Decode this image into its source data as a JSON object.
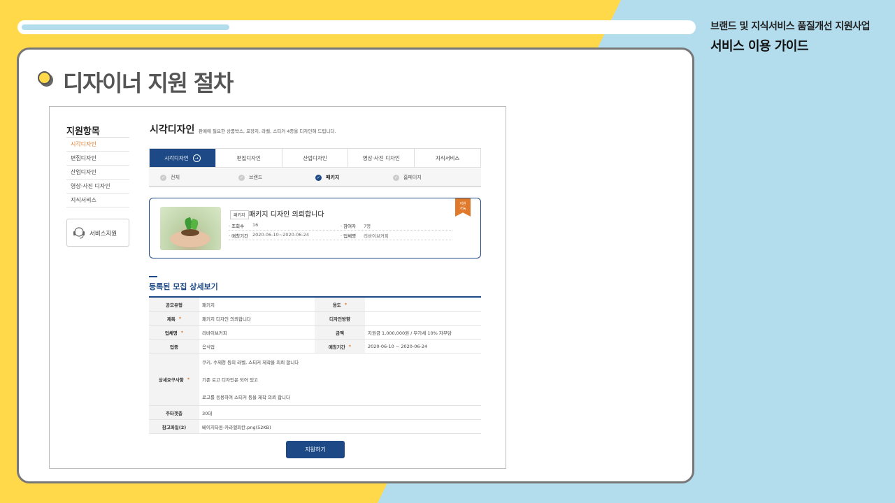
{
  "header": {
    "progress": 0.31,
    "guide_subtitle": "브랜드 및 지식서비스 품질개선 지원사업",
    "guide_title": "서비스 이용 가이드",
    "section_title": "디자이너 지원 절차"
  },
  "colors": {
    "accent_yellow": "#ffd94a",
    "accent_blue": "#b3dced",
    "navy": "#1d4a86",
    "orange": "#e07a2a"
  },
  "sidebar": {
    "heading": "지원항목",
    "items": [
      {
        "label": "시각디자인",
        "active": true
      },
      {
        "label": "편집디자인"
      },
      {
        "label": "산업디자인"
      },
      {
        "label": "영상·사진 디자인"
      },
      {
        "label": "지식서비스"
      }
    ],
    "service_button": {
      "label": "서비스지원",
      "icon": "headset-icon"
    }
  },
  "page": {
    "heading": "시각디자인",
    "description": "판매에 필요한 상품박스, 포장지, 라벨, 스티커 4종을 디자인해 드립니다."
  },
  "tabs": [
    {
      "label": "시각디자인",
      "active": true
    },
    {
      "label": "편집디자인"
    },
    {
      "label": "산업디자인"
    },
    {
      "label": "영상·사진 디자인"
    },
    {
      "label": "지식서비스"
    }
  ],
  "subtabs": [
    {
      "label": "전체"
    },
    {
      "label": "브랜드"
    },
    {
      "label": "패키지",
      "active": true
    },
    {
      "label": "홈페이지"
    }
  ],
  "listing": {
    "category_tag": "패키지",
    "title": "패키지 디자인 의뢰합니다",
    "views_label": "조회수",
    "views": "16",
    "applicants_label": "참여자",
    "applicants": "7명",
    "period_label": "매칭기간",
    "period": "2020-06-10~2020-06-24",
    "company_label": "업체명",
    "company": "리바이브커피",
    "ribbon": [
      "지원",
      "가능"
    ]
  },
  "detail": {
    "heading": "등록된 모집 상세보기",
    "rows": {
      "r1": {
        "l1": "공모유형",
        "v1": "패키지",
        "l2": "용도",
        "v2": ""
      },
      "r2": {
        "l1": "제목",
        "v1": "패키지 디자인 의뢰합니다",
        "l2": "디자인방향",
        "v2": ""
      },
      "r3": {
        "l1": "업체명",
        "v1": "리바이브커피",
        "l2": "금액",
        "v2": "지원금 1,000,000원 / 부가세 10% 자부담"
      },
      "r4": {
        "l1": "업종",
        "v1": "음식업",
        "l2": "매칭기간",
        "v2": "2020-06-10 ~ 2020-06-24"
      },
      "r5": {
        "l1": "상세요구사항",
        "lines": [
          "쿠키, 수제청 등의 라벨, 스티커 제작을 의뢰 합니다",
          "기존 로고 디자인은 되어 있고",
          "로고를 응용하여 스티커 등을 제작 의뢰 합니다"
        ]
      },
      "r6": {
        "l1": "주타겟층",
        "v1": "30대"
      },
      "r7": {
        "l1": "참고파일(2)",
        "v1": "베이지타원-카라멜피칸.png(52KB)"
      }
    },
    "required_mark": "*"
  },
  "apply_button": "지원하기"
}
